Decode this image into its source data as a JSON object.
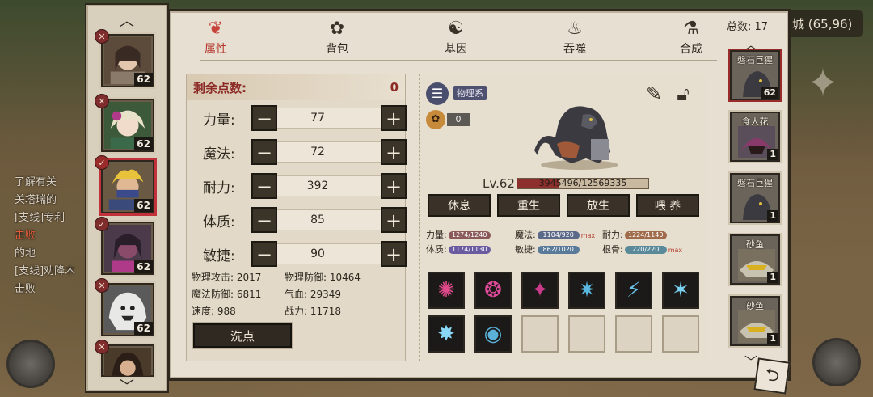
{
  "tabs": [
    {
      "label": "属性",
      "icon": "flame-icon",
      "glyph": "❦"
    },
    {
      "label": "背包",
      "icon": "bag-icon",
      "glyph": "✿"
    },
    {
      "label": "基因",
      "icon": "dna-icon",
      "glyph": "☯"
    },
    {
      "label": "吞噬",
      "icon": "devour-icon",
      "glyph": "♨"
    },
    {
      "label": "合成",
      "icon": "merge-icon",
      "glyph": "⚗"
    }
  ],
  "world": {
    "coord": "城 (65,96)",
    "chat": [
      "了解有关",
      "关塔瑞的",
      "[支线]专利",
      "击败",
      "的地",
      "[支线]劝降木",
      "击败"
    ]
  },
  "heroes": [
    {
      "level": "62",
      "pin": "✕"
    },
    {
      "level": "62",
      "pin": "✕"
    },
    {
      "level": "62",
      "pin": "✓"
    },
    {
      "level": "62",
      "pin": "✓"
    },
    {
      "level": "62",
      "pin": "✕"
    },
    {
      "level": "62",
      "pin": "✕"
    }
  ],
  "attributes": {
    "remaining_label": "剩余点数:",
    "remaining_value": "0",
    "rows": [
      {
        "label": "力量:",
        "value": "77"
      },
      {
        "label": "魔法:",
        "value": "72"
      },
      {
        "label": "耐力:",
        "value": "392"
      },
      {
        "label": "体质:",
        "value": "85"
      },
      {
        "label": "敏捷:",
        "value": "90"
      }
    ],
    "derived": [
      [
        "物理攻击: 2017",
        "物理防御: 10464"
      ],
      [
        "魔法防御: 6811",
        "气血: 29349"
      ],
      [
        "速度: 988",
        "战力: 11718"
      ]
    ],
    "reset_label": "洗点"
  },
  "pet": {
    "type_label": "物理系",
    "paw_count": "0",
    "level_text": "Lv.62",
    "exp_text": "3945496/12569335",
    "exp_fraction": 0.314,
    "actions": [
      "休息",
      "重生",
      "放生",
      "喂 养"
    ],
    "stats": [
      {
        "label": "力量:",
        "bar": "1274/1240",
        "color": "#8a5a5a"
      },
      {
        "label": "魔法:",
        "bar": "1104/920",
        "color": "#5c6a8a",
        "max": "max"
      },
      {
        "label": "耐力:",
        "bar": "1224/1140",
        "color": "#a06b4a"
      },
      {
        "label": "体质:",
        "bar": "1174/1130",
        "color": "#6a5ba0"
      },
      {
        "label": "敏捷:",
        "bar": "862/1020",
        "color": "#5a7a9a"
      },
      {
        "label": "根骨:",
        "bar": "220/220",
        "color": "#5a8a9a",
        "max": "max"
      }
    ],
    "skills": [
      {
        "icon": "crimson-burst-icon",
        "glyph": "✺",
        "color": "#e04a8a"
      },
      {
        "icon": "crimson-swirl-icon",
        "glyph": "❂",
        "color": "#e04a9a"
      },
      {
        "icon": "crimson-shield-icon",
        "glyph": "✦",
        "color": "#c83a8a"
      },
      {
        "icon": "ice-shatter-icon",
        "glyph": "✷",
        "color": "#5ab8e0"
      },
      {
        "icon": "ice-claw-icon",
        "glyph": "⚡",
        "color": "#6ac0e8"
      },
      {
        "icon": "ice-shards-icon",
        "glyph": "✶",
        "color": "#7ad0f0"
      },
      {
        "icon": "ice-star-icon",
        "glyph": "✸",
        "color": "#8ad8f8"
      },
      {
        "icon": "ice-wave-icon",
        "glyph": "◉",
        "color": "#5ab0d8"
      }
    ]
  },
  "roster": {
    "total_label": "总数: 17",
    "pets": [
      {
        "name": "磐石巨猩",
        "level": "62"
      },
      {
        "name": "食人花",
        "level": "1"
      },
      {
        "name": "磐石巨猩",
        "level": "1"
      },
      {
        "name": "砂鱼",
        "level": "1"
      },
      {
        "name": "砂鱼",
        "level": "1"
      }
    ]
  }
}
